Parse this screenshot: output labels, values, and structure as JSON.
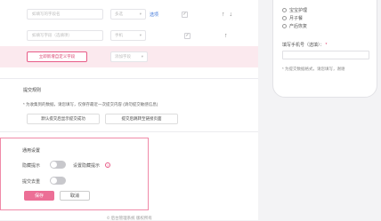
{
  "form_rows": [
    {
      "name_placeholder": "如填写的字段名",
      "type": "多选",
      "edit_label": "选项",
      "checked": "✓",
      "arrows": [
        "↑",
        "↓"
      ]
    },
    {
      "name_placeholder": "如填写字段（选填项）",
      "type": "手机",
      "checked": "✓",
      "arrows": [
        "↑"
      ]
    }
  ],
  "add_row": {
    "button_label": "立即新增自定义字段",
    "select_placeholder": "添加字段"
  },
  "submit_rules": {
    "title": "提交规则",
    "hint": "* 为收集到的数据，请您填写，仅保存最近一次提交内容 (请勿提交敏感信息)",
    "button_left": "默认提交后显示提交成功",
    "button_right": "提交后跳转至链接页面"
  },
  "settings": {
    "title": "通用设置",
    "row1_label": "隐藏提示",
    "row1_right_label": "设置隐藏提示",
    "help_icon": "?",
    "row2_label": "提交去重",
    "save_label": "保存",
    "cancel_label": "取消"
  },
  "phone_preview": {
    "options": [
      "宝宝护理",
      "月子餐",
      "产后恢复"
    ],
    "field_label": "填写手机号（选填）：",
    "field_required_mark": "*",
    "note": "* 为提交数据格式，请您填写，谢谢"
  },
  "footer_text": "© 后台管理系统 版权所有"
}
